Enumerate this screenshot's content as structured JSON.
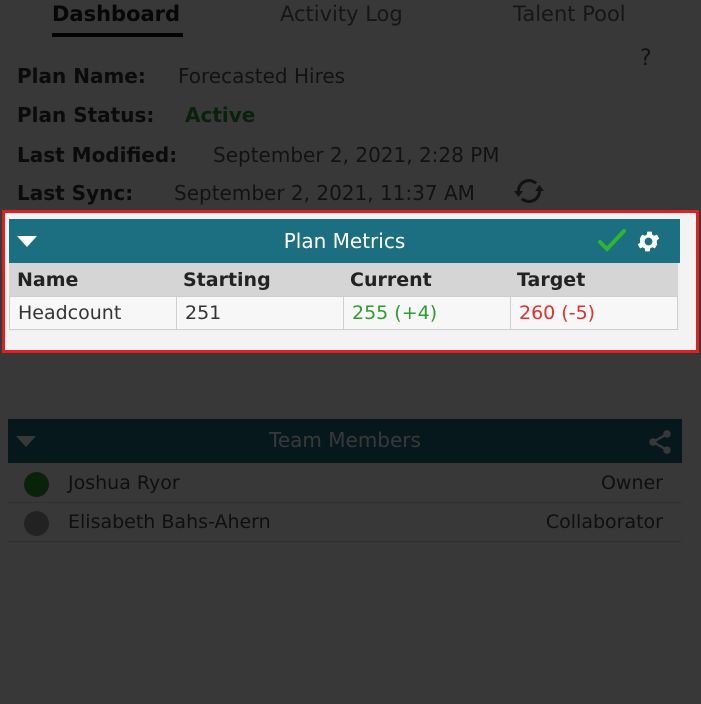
{
  "tabs": [
    {
      "label": "Dashboard",
      "active": true
    },
    {
      "label": "Activity Log",
      "active": false
    },
    {
      "label": "Talent Pool",
      "active": false
    }
  ],
  "help_label": "?",
  "plan": {
    "name_label": "Plan Name:",
    "name_value": "Forecasted Hires",
    "status_label": "Plan Status:",
    "status_value": "Active",
    "modified_label": "Last Modified:",
    "modified_value": "September 2, 2021, 2:28 PM",
    "sync_label": "Last Sync:",
    "sync_value": "September 2, 2021, 11:37 AM"
  },
  "metrics": {
    "title": "Plan Metrics",
    "columns": [
      "Name",
      "Starting",
      "Current",
      "Target"
    ],
    "rows": [
      {
        "name": "Headcount",
        "starting": "251",
        "current": "255 (+4)",
        "target": "260 (-5)"
      }
    ]
  },
  "team": {
    "title": "Team Members",
    "members": [
      {
        "name": "Joshua Ryor",
        "role": "Owner",
        "status_color": "#2e9b2e"
      },
      {
        "name": "Elisabeth Bahs-Ahern",
        "role": "Collaborator",
        "status_color": "#9a9a9a"
      }
    ]
  },
  "colors": {
    "header_teal": "#1b6f80",
    "positive": "#2e9b2e",
    "negative": "#e03030",
    "highlight": "#e02020"
  }
}
